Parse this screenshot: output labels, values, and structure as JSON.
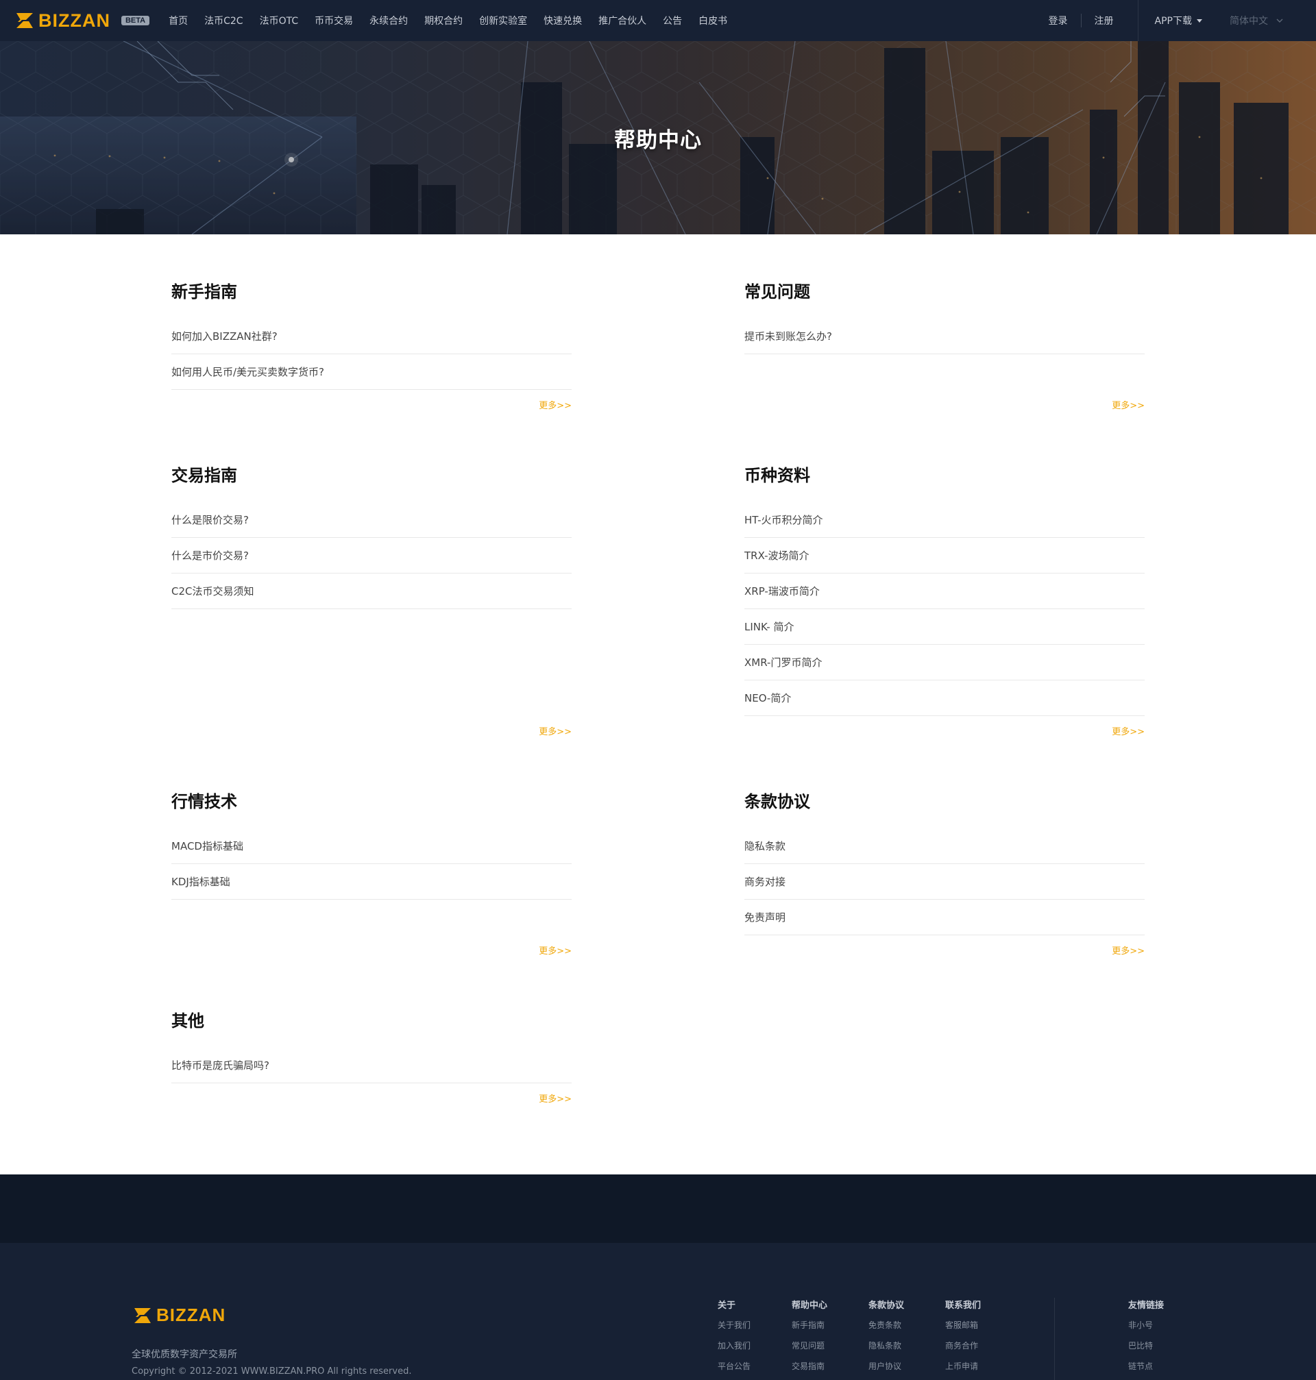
{
  "navbar": {
    "brand": "BIZZAN",
    "beta": "BETA",
    "links": [
      "首页",
      "法币C2C",
      "法币OTC",
      "币币交易",
      "永续合约",
      "期权合约",
      "创新实验室",
      "快速兑换",
      "推广合伙人",
      "公告",
      "白皮书"
    ],
    "login": "登录",
    "register": "注册",
    "app_download": "APP下载",
    "language": "简体中文"
  },
  "banner": {
    "title": "帮助中心"
  },
  "sections": {
    "newbie": {
      "title": "新手指南",
      "items": [
        "如何加入BIZZAN社群?",
        "如何用人民币/美元买卖数字货币?"
      ],
      "more": "更多>>"
    },
    "faq": {
      "title": "常见问题",
      "items": [
        "提币未到账怎么办?"
      ],
      "more": "更多>>"
    },
    "trade": {
      "title": "交易指南",
      "items": [
        "什么是限价交易?",
        "什么是市价交易?",
        "C2C法币交易须知"
      ],
      "more": "更多>>"
    },
    "coins": {
      "title": "币种资料",
      "items": [
        "HT-火币积分简介",
        "TRX-波场简介",
        "XRP-瑞波币简介",
        "LINK- 简介",
        "XMR-门罗币简介",
        "NEO-简介"
      ],
      "more": "更多>>"
    },
    "market": {
      "title": "行情技术",
      "items": [
        "MACD指标基础",
        "KDJ指标基础"
      ],
      "more": "更多>>"
    },
    "terms": {
      "title": "条款协议",
      "items": [
        "隐私条款",
        "商务对接",
        "免责声明"
      ],
      "more": "更多>>"
    },
    "other": {
      "title": "其他",
      "items": [
        "比特币是庞氏骗局吗?"
      ],
      "more": "更多>>"
    }
  },
  "footer": {
    "brand": "BIZZAN",
    "slogan": "全球优质数字资产交易所",
    "copyright": "Copyright © 2012-2021 WWW.BIZZAN.PRO All rights reserved.",
    "columns": [
      {
        "title": "关于",
        "items": [
          "关于我们",
          "加入我们",
          "平台公告"
        ]
      },
      {
        "title": "帮助中心",
        "items": [
          "新手指南",
          "常见问题",
          "交易指南"
        ]
      },
      {
        "title": "条款协议",
        "items": [
          "免责条款",
          "隐私条款",
          "用户协议"
        ]
      },
      {
        "title": "联系我们",
        "items": [
          "客服邮箱",
          "商务合作",
          "上币申请"
        ]
      },
      {
        "title": "友情链接",
        "items": [
          "非小号",
          "巴比特",
          "链节点"
        ]
      }
    ]
  },
  "colors": {
    "accent": "#f0a70a",
    "nav_bg": "#172134",
    "footer_band": "#0f1827"
  },
  "icons": [
    "bizzan-logo-icon",
    "caret-down-icon",
    "chevron-down-icon"
  ]
}
